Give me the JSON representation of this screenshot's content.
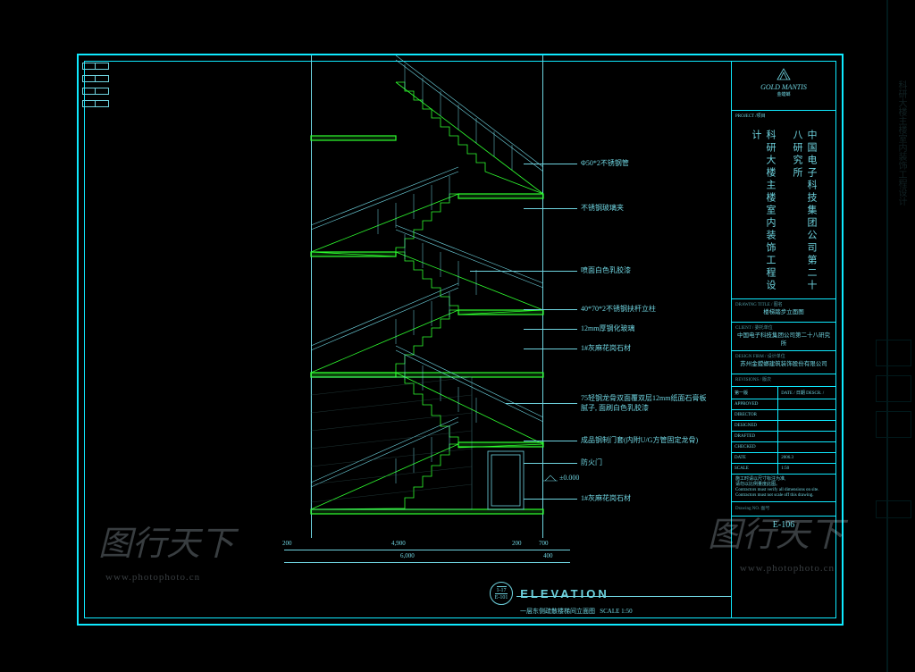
{
  "logo": {
    "brand": "GOLD MANTIS",
    "sub": "金螳螂"
  },
  "project": {
    "title_line1": "科研大楼主楼室内装饰工程设计",
    "title_line2": "中国电子科技集团公司第二十八研究所"
  },
  "titleblock": {
    "project_label": "PROJECT /项目",
    "drawing_title_label": "DRAWING TITLE / 图名",
    "drawing_title": "楼梯踏步立面图",
    "client_label": "CLIENT / 委托单位",
    "client": "中国电子科技集团公司第二十八研究所",
    "design_firm_label": "DESIGN FIRM / 设计单位",
    "design_firm": "苏州金螳螂建筑装饰股份有限公司",
    "revisions_label": "REVISIONS / 版次",
    "rev_no": "第一版",
    "rev_date": "DATE / 日期",
    "rev_desc": "DESCR. /",
    "approved": "APPROVED",
    "director": "DIRECTOR",
    "designed": "DESIGNED",
    "drafted": "DRAFTED",
    "checked": "CHECKED",
    "date": "DATE",
    "date_val": "2006.3",
    "scale": "SCALE",
    "scale_val": "1:50",
    "drawing_no": "Drawing NO. 图号",
    "drawing_no_val": "E-106",
    "note": "施工时请以尺寸标注为准,\n请勿以比例量度此图。\nContractors must verify all dimensions on site.\nContractors must not scale off this drawing."
  },
  "annotations": [
    "Φ50*2不锈钢管",
    "不锈钢玻璃夹",
    "喷面白色乳胶漆",
    "40*70*2不锈钢扶杆立柱",
    "12mm厚钢化玻璃",
    "1#灰麻花岗石材",
    "75轻钢龙骨双面覆双层12mm纸面石膏板\n腻子, 面刷白色乳胶漆",
    "成品钢制门套(内附U/G方管固定龙骨)",
    "防火门",
    "1#灰麻花岗石材"
  ],
  "level": "±0.000",
  "dimensions": {
    "segs_top": [
      "200",
      "4,900",
      "200",
      "700"
    ],
    "total": "6,000",
    "right": "400"
  },
  "elevation": {
    "tag_top": "1-17",
    "tag_bot": "E-101",
    "title": "ELEVATION",
    "subtitle": "一层东侧疏散楼梯间立面图",
    "scale_label": "SCALE",
    "scale_val": "1:50"
  },
  "watermark": {
    "cn": "图行天下",
    "en": "www.photophoto.cn"
  }
}
